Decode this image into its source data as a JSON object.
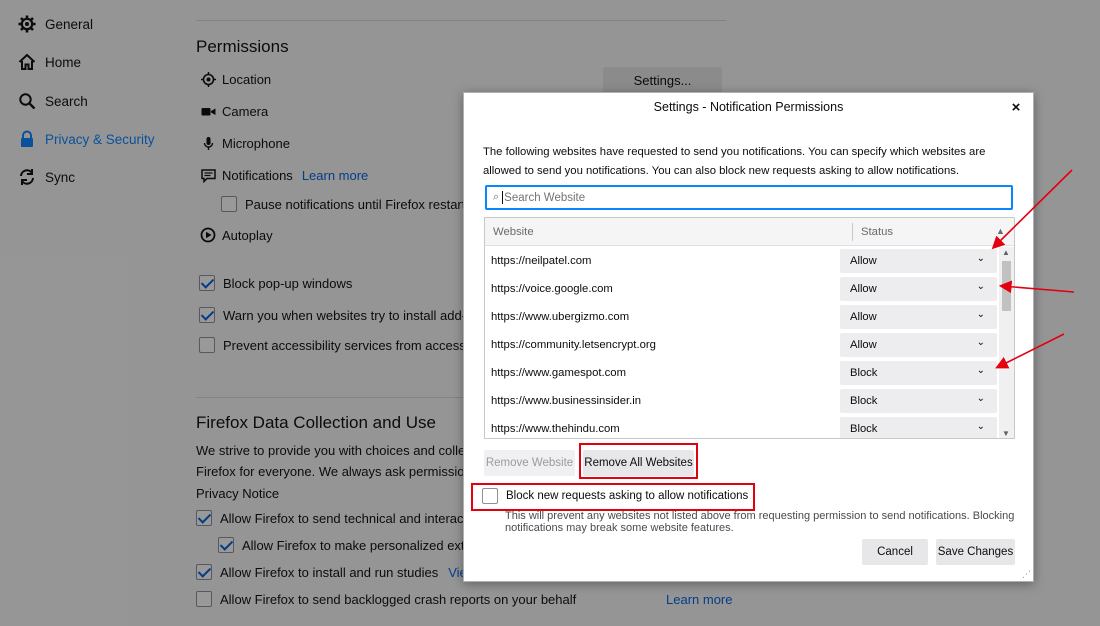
{
  "sidebar": {
    "items": [
      {
        "label": "General",
        "icon": "gear-icon"
      },
      {
        "label": "Home",
        "icon": "home-icon"
      },
      {
        "label": "Search",
        "icon": "search-icon"
      },
      {
        "label": "Privacy & Security",
        "icon": "lock-icon",
        "active": true
      },
      {
        "label": "Sync",
        "icon": "sync-icon"
      }
    ]
  },
  "permissions": {
    "heading": "Permissions",
    "location": "Location",
    "camera": "Camera",
    "microphone": "Microphone",
    "notifications": "Notifications",
    "learn_more": "Learn more",
    "pause_notifications": "Pause notifications until Firefox restarts",
    "autoplay": "Autoplay",
    "settings_button": "Settings...",
    "block_popups": "Block pop-up windows",
    "warn_addons": "Warn you when websites try to install add-ons",
    "prevent_accessibility": "Prevent accessibility services from accessing y"
  },
  "data_collection": {
    "heading": "Firefox Data Collection and Use",
    "para_line1": "We strive to provide you with choices and collect o",
    "para_line2": "Firefox for everyone. We always ask permission bef",
    "privacy_notice": "Privacy Notice",
    "allow_technical": "Allow Firefox to send technical and interaction",
    "allow_personalized": "Allow Firefox to make personalized extens",
    "allow_studies": "Allow Firefox to install and run studies",
    "view_link": "View F",
    "allow_crash": "Allow Firefox to send backlogged crash reports on your behalf",
    "learn_more": "Learn more"
  },
  "dialog": {
    "title": "Settings - Notification Permissions",
    "close": "×",
    "description": "The following websites have requested to send you notifications. You can specify which websites are allowed to send you notifications. You can also block new requests asking to allow notifications.",
    "search_placeholder": "Search Website",
    "columns": {
      "website": "Website",
      "status": "Status"
    },
    "sites": [
      {
        "url": "https://neilpatel.com",
        "status": "Allow"
      },
      {
        "url": "https://voice.google.com",
        "status": "Allow"
      },
      {
        "url": "https://www.ubergizmo.com",
        "status": "Allow"
      },
      {
        "url": "https://community.letsencrypt.org",
        "status": "Allow"
      },
      {
        "url": "https://www.gamespot.com",
        "status": "Block"
      },
      {
        "url": "https://www.businessinsider.in",
        "status": "Block"
      },
      {
        "url": "https://www.thehindu.com",
        "status": "Block"
      }
    ],
    "remove_website": "Remove Website",
    "remove_all": "Remove All Websites",
    "block_new_label": "Block new requests asking to allow notifications",
    "block_new_note": "This will prevent any websites not listed above from requesting permission to send notifications. Blocking notifications may break some website features.",
    "cancel": "Cancel",
    "save": "Save Changes"
  },
  "colors": {
    "accent": "#0a84ff",
    "annotation_red": "#e3000f",
    "link": "#0060df"
  }
}
